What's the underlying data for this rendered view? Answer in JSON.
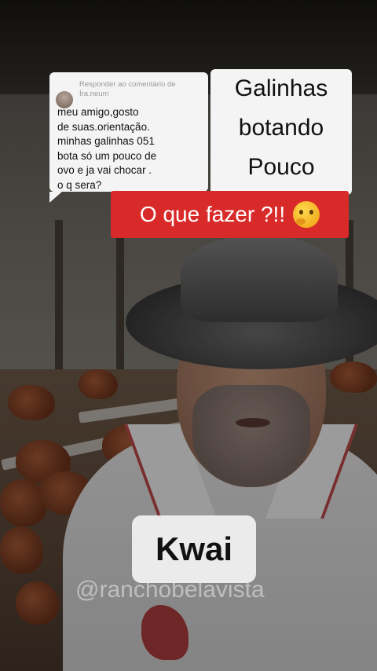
{
  "comment": {
    "header": "Responder ao comentário de Íra.neum",
    "body_lines": [
      "meu amigo,gosto",
      "de suas.orientação.",
      "minhas galinhas 051",
      "bota só um pouco de",
      "ovo e ja vai chocar .",
      "o q sera?"
    ],
    "avatar_icon": "user-avatar-icon"
  },
  "title": {
    "lines": [
      "Galinhas",
      "botando",
      "Pouco"
    ]
  },
  "banner": {
    "text": "O que fazer ?!!",
    "icon": "thinking-face-icon",
    "color": "#d92a2a"
  },
  "watermark": {
    "brand": "Kwai",
    "handle": "@ranchobelavista"
  }
}
